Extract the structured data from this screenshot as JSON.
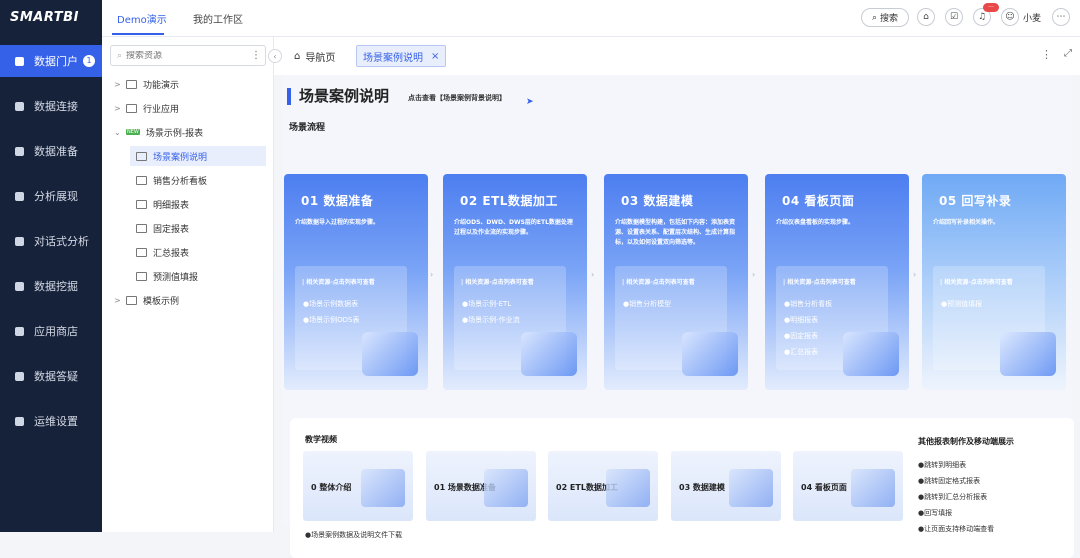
{
  "app": {
    "logo": "SMARTBI"
  },
  "sidebar": {
    "items": [
      {
        "label": "数据门户",
        "badge": "1",
        "icon": "monitor-icon"
      },
      {
        "label": "数据连接",
        "icon": "database-icon"
      },
      {
        "label": "数据准备",
        "icon": "server-icon"
      },
      {
        "label": "分析展现",
        "icon": "bar-chart-icon"
      },
      {
        "label": "对话式分析",
        "icon": "chat-icon"
      },
      {
        "label": "数据挖掘",
        "icon": "pick-icon"
      },
      {
        "label": "应用商店",
        "icon": "apps-icon"
      },
      {
        "label": "数据答疑",
        "icon": "question-icon"
      },
      {
        "label": "运维设置",
        "icon": "gear-icon"
      }
    ]
  },
  "header": {
    "tabs": [
      "Demo演示",
      "我的工作区"
    ],
    "search_label": "搜索",
    "notification_badge": "···",
    "user_name": "小麦"
  },
  "tree": {
    "search_placeholder": "搜索资源",
    "nodes": [
      {
        "label": "功能演示",
        "arrow": ">"
      },
      {
        "label": "行业应用",
        "arrow": ">"
      },
      {
        "label": "场景示例-报表",
        "arrow": "⌄",
        "tag": "NEW"
      },
      {
        "label": "场景案例说明",
        "selected": true
      },
      {
        "label": "销售分析看板"
      },
      {
        "label": "明细报表"
      },
      {
        "label": "固定报表"
      },
      {
        "label": "汇总报表"
      },
      {
        "label": "预测值填报"
      },
      {
        "label": "模板示例",
        "arrow": ">"
      }
    ]
  },
  "tabs": {
    "home": "导航页",
    "current": "场景案例说明",
    "close": "×"
  },
  "page": {
    "title": "场景案例说明",
    "title_link": "点击查看【场景案例背景说明】",
    "flow_label": "场景流程",
    "resource_label": "| 相关资源-点击列表可查看",
    "cards": [
      {
        "title": "01 数据准备",
        "desc": "介绍数据导入过程的实现步骤。",
        "items": [
          "●场景示例数据表",
          "●场景示例ODS表"
        ]
      },
      {
        "title": "02 ETL数据加工",
        "desc": "介绍ODS、DWD、DWS层的ETL数据处理过程以及作业流的实现步骤。",
        "items": [
          "●场景示例-ETL",
          "●场景示例-作业流"
        ]
      },
      {
        "title": "03 数据建模",
        "desc": "介绍数据模型构建，包括如下内容：添加表资源、设置表关系、配置层次结构、生成计算指标，以及如何设置双向筛选等。",
        "items": [
          "●销售分析模型"
        ]
      },
      {
        "title": "04 看板页面",
        "desc": "介绍仪表盘看板的实现步骤。",
        "items": [
          "●销售分析看板",
          "●明细报表",
          "●固定报表",
          "●汇总报表"
        ]
      },
      {
        "title": "05 回写补录",
        "desc": "介绍回写补录相关操作。",
        "items": [
          "●预测值填报"
        ]
      }
    ],
    "video_label": "教学视频",
    "videos": [
      "0 整体介绍",
      "01 场景数据准备",
      "02 ETL数据加工",
      "03 数据建模",
      "04 看板页面"
    ],
    "download_text": "●场景案例数据及说明文件下载",
    "other_title": "其他报表制作及移动端展示",
    "other_items": [
      "●跳转到明细表",
      "●跳转固定格式报表",
      "●跳转到汇总分析报表",
      "●回写填报",
      "●让页面支持移动端查看"
    ]
  }
}
